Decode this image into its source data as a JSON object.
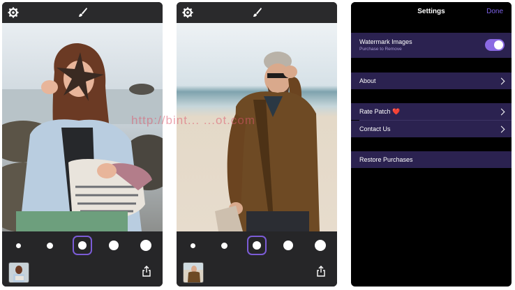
{
  "screens": [
    {
      "toolbar": {
        "left_icon": "gear-icon",
        "center_icon": "brush-icon"
      },
      "brush_sizes": [
        "xs",
        "s",
        "m",
        "l",
        "xl"
      ],
      "selected_brush_size": "m",
      "bottom": {
        "thumbnail_icon": "photo-thumbnail",
        "right_icon": "share-icon"
      }
    },
    {
      "toolbar": {
        "left_icon": "gear-icon",
        "center_icon": "brush-icon"
      },
      "brush_sizes": [
        "xs",
        "s",
        "m",
        "l",
        "xl"
      ],
      "selected_brush_size": "m",
      "bottom": {
        "thumbnail_icon": "photo-thumbnail",
        "right_icon": "share-icon"
      }
    }
  ],
  "settings": {
    "title": "Settings",
    "done_label": "Done",
    "watermark": {
      "label": "Watermark Images",
      "sublabel": "Purchase to Remove",
      "enabled": true
    },
    "about_label": "About",
    "rate_label": "Rate Patch ❤️",
    "contact_label": "Contact Us",
    "restore_label": "Restore Purchases"
  },
  "watermark_overlay": "http://bint... ...ot.com",
  "colors": {
    "accent": "#7b5cd6",
    "row_bg": "#2b2250",
    "toolbar_bg": "#2a2a2c"
  }
}
